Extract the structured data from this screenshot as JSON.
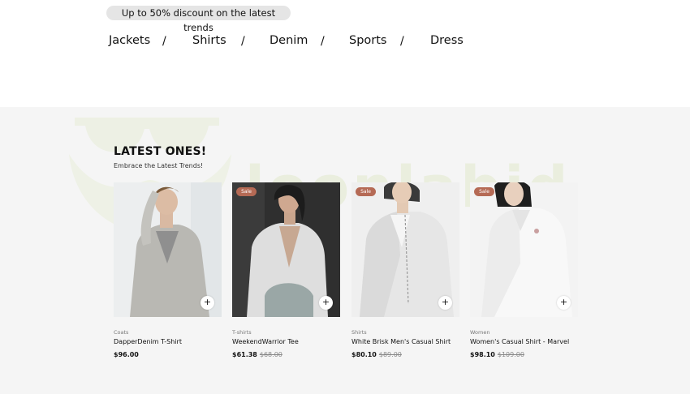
{
  "promo": {
    "text": "Up to 50% discount on the latest trends"
  },
  "categories": [
    "Jackets",
    "Shirts",
    "Denim",
    "Sports",
    "Dress"
  ],
  "separator": "/",
  "section": {
    "title": "LATEST ONES!",
    "subtitle": "Embrace the Latest Trends!",
    "watermark_text": "loonlabid"
  },
  "products": [
    {
      "category": "Coats",
      "name": "DapperDenim T-Shirt",
      "price": "$96.00",
      "old_price": "",
      "badge": "",
      "add_icon": "+"
    },
    {
      "category": "T-shirts",
      "name": "WeekendWarrior Tee",
      "price": "$61.38",
      "old_price": "$68.00",
      "badge": "Sale",
      "add_icon": "+"
    },
    {
      "category": "Shirts",
      "name": "White Brisk Men's Casual Shirt",
      "price": "$80.10",
      "old_price": "$89.00",
      "badge": "Sale",
      "add_icon": "+"
    },
    {
      "category": "Women",
      "name": "Women's Casual Shirt - Marvel",
      "price": "$98.10",
      "old_price": "$109.00",
      "badge": "Sale",
      "add_icon": "+"
    }
  ],
  "colors": {
    "sale_badge": "#b56a55",
    "section_bg": "#f5f5f5",
    "watermark": "#eaeede"
  }
}
